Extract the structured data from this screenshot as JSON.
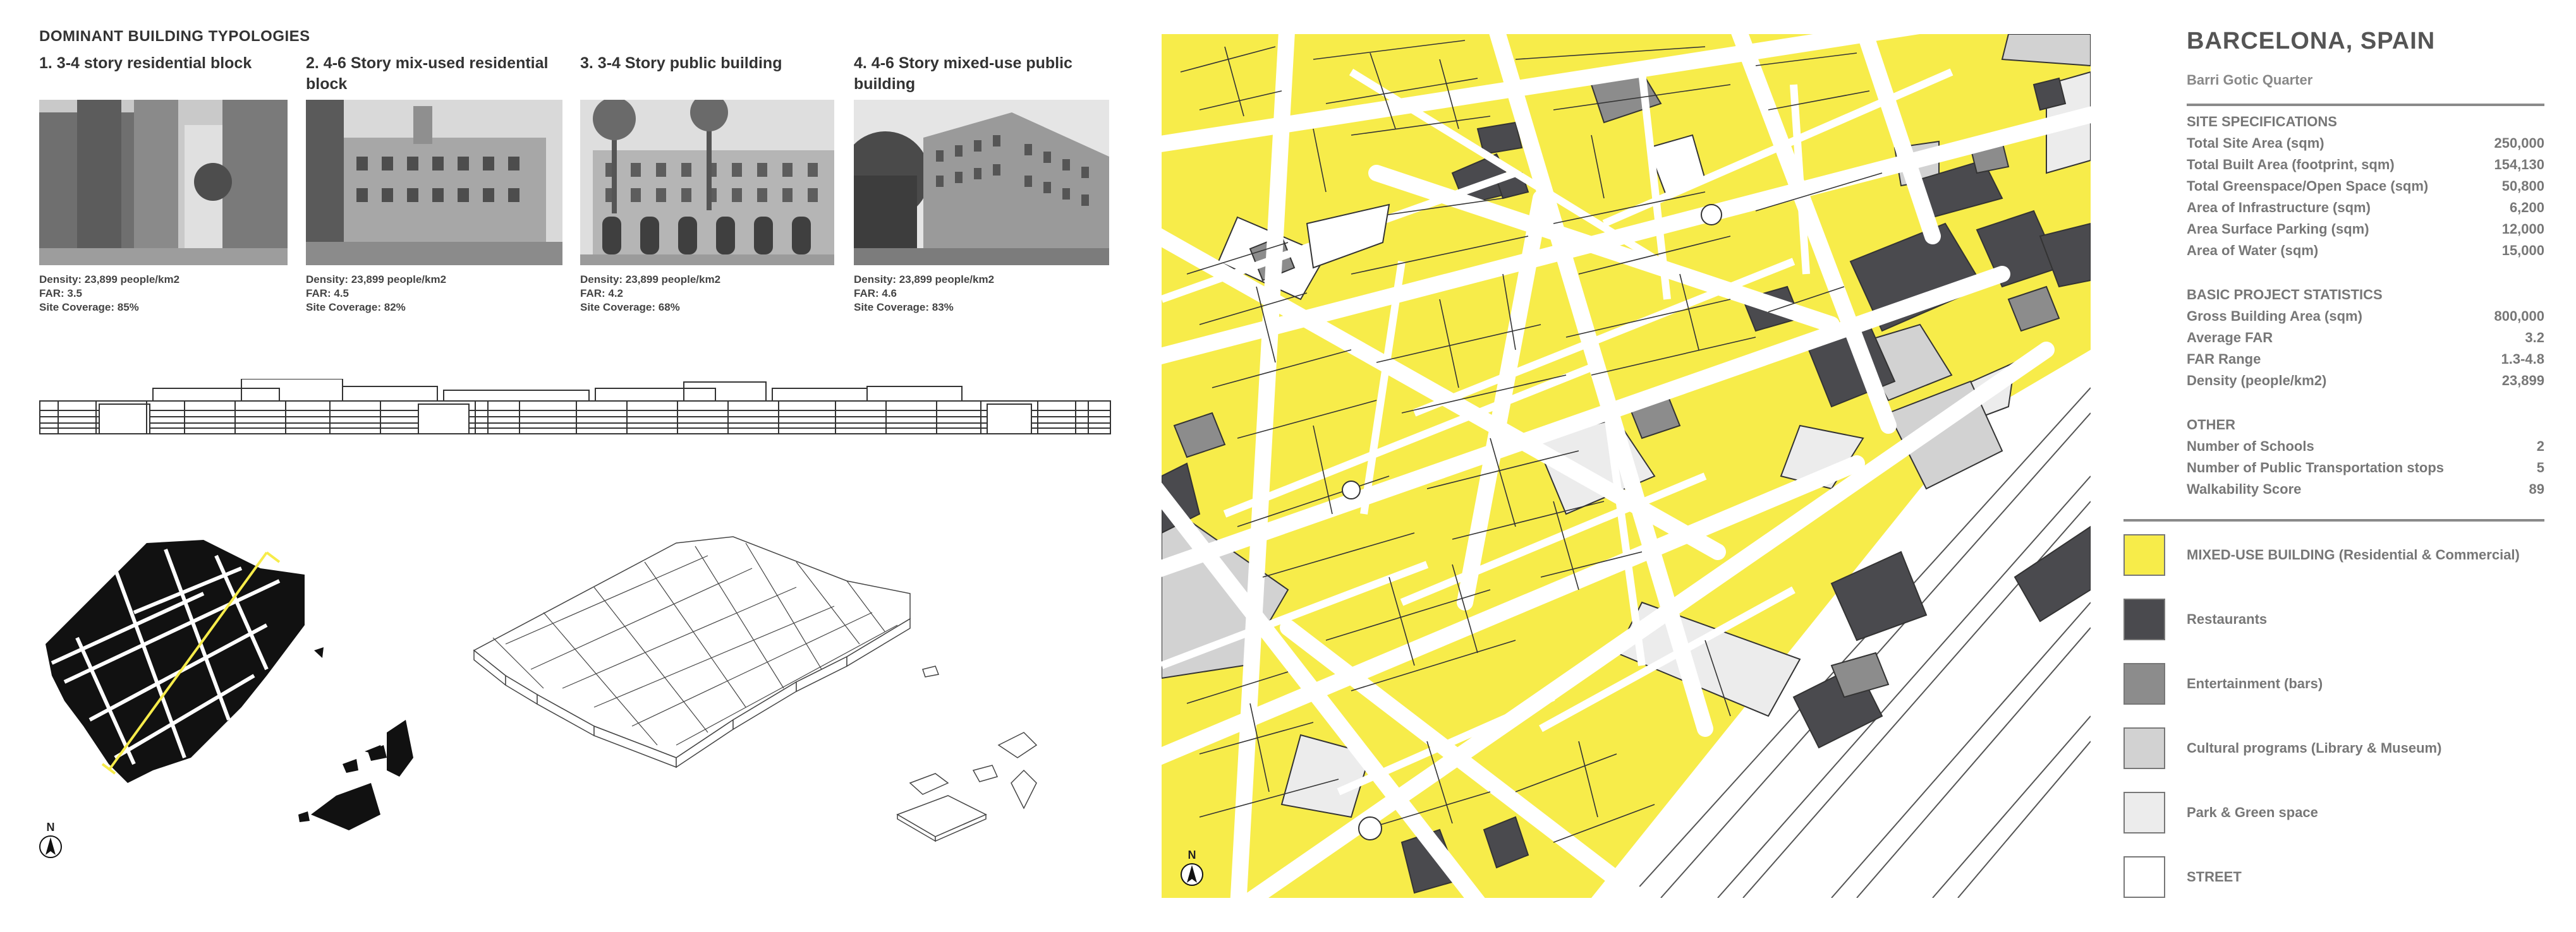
{
  "typologies": {
    "heading": "DOMINANT BUILDING TYPOLOGIES",
    "items": [
      {
        "title_line1": "1. 3-4 story residential block",
        "title_line2": "",
        "density": "Density: 23,899 people/km2",
        "far": "FAR: 3.5",
        "coverage": "Site Coverage: 85%"
      },
      {
        "title_line1": "2. 4-6 Story mix-used residential",
        "title_line2": "block",
        "density": "Density: 23,899 people/km2",
        "far": "FAR: 4.5",
        "coverage": "Site Coverage: 82%"
      },
      {
        "title_line1": "3. 3-4 Story public building",
        "title_line2": "",
        "density": "Density: 23,899 people/km2",
        "far": "FAR: 4.2",
        "coverage": "Site Coverage: 68%"
      },
      {
        "title_line1": "4. 4-6 Story mixed-use public",
        "title_line2": "building",
        "density": "Density: 23,899 people/km2",
        "far": "FAR: 4.6",
        "coverage": "Site Coverage: 83%"
      }
    ]
  },
  "north_label": "N",
  "site": {
    "title": "BARCELONA, SPAIN",
    "subtitle": "Barri Gotic Quarter",
    "specs_heading": "SITE SPECIFICATIONS",
    "specs": [
      {
        "label": "Total Site Area (sqm)",
        "value": "250,000"
      },
      {
        "label": "Total Built Area (footprint, sqm)",
        "value": "154,130"
      },
      {
        "label": "Total Greenspace/Open Space (sqm)",
        "value": "50,800"
      },
      {
        "label": "Area of Infrastructure (sqm)",
        "value": "6,200"
      },
      {
        "label": "Area Surface Parking (sqm)",
        "value": "12,000"
      },
      {
        "label": "Area of Water (sqm)",
        "value": "15,000"
      }
    ],
    "stats_heading": "BASIC PROJECT STATISTICS",
    "stats": [
      {
        "label": "Gross Building Area (sqm)",
        "value": "800,000"
      },
      {
        "label": "Average FAR",
        "value": "3.2"
      },
      {
        "label": "FAR Range",
        "value": "1.3-4.8"
      },
      {
        "label": "Density (people/km2)",
        "value": "23,899"
      }
    ],
    "other_heading": "OTHER",
    "other": [
      {
        "label": "Number of Schools",
        "value": "2"
      },
      {
        "label": "Number of Public Transportation stops",
        "value": "5"
      },
      {
        "label": "Walkability Score",
        "value": "89"
      }
    ]
  },
  "legend": [
    {
      "label": "MIXED-USE BUILDING (Residential & Commercial)",
      "color": "#f7ec4a"
    },
    {
      "label": "Restaurants",
      "color": "#4a4a4e"
    },
    {
      "label": "Entertainment (bars)",
      "color": "#8c8c8c"
    },
    {
      "label": "Cultural programs (Library & Museum)",
      "color": "#d2d2d2"
    },
    {
      "label": "Park & Green space",
      "color": "#ececec"
    },
    {
      "label": "STREET",
      "color": "#ffffff"
    }
  ],
  "colors": {
    "yellow": "#f7ec4a",
    "dark": "#4a4a4e",
    "mid": "#8c8c8c",
    "light": "#d2d2d2",
    "pale": "#ececec"
  }
}
